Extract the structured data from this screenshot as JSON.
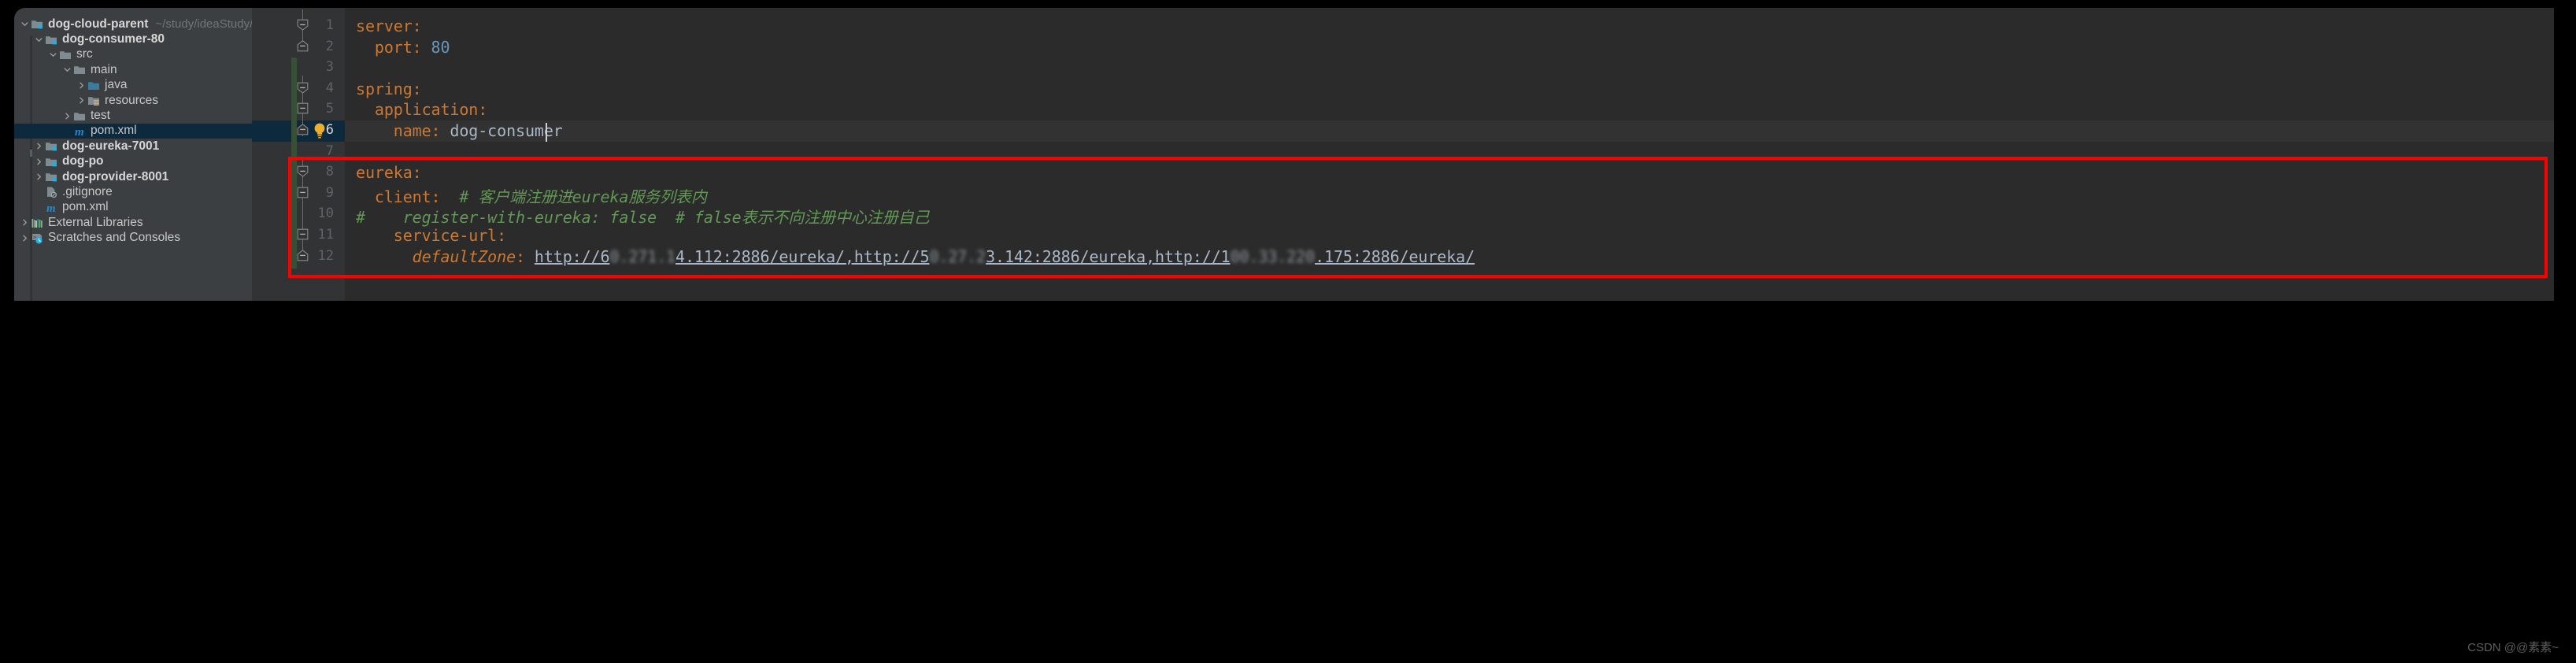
{
  "sidebar": {
    "items": [
      {
        "label": "dog-cloud-parent",
        "path": "~/study/ideaStudy/ideaS",
        "indent": 0,
        "arrow": "down",
        "icon": "module-folder-icon",
        "bold": true,
        "selected": false
      },
      {
        "label": "dog-consumer-80",
        "path": "",
        "indent": 1,
        "arrow": "down",
        "icon": "module-folder-icon",
        "bold": true,
        "selected": false
      },
      {
        "label": "src",
        "path": "",
        "indent": 2,
        "arrow": "down",
        "icon": "folder-icon",
        "bold": false,
        "selected": false
      },
      {
        "label": "main",
        "path": "",
        "indent": 3,
        "arrow": "down",
        "icon": "folder-icon",
        "bold": false,
        "selected": false
      },
      {
        "label": "java",
        "path": "",
        "indent": 4,
        "arrow": "right",
        "icon": "source-folder-icon",
        "bold": false,
        "selected": false
      },
      {
        "label": "resources",
        "path": "",
        "indent": 4,
        "arrow": "right",
        "icon": "resources-folder-icon",
        "bold": false,
        "selected": false
      },
      {
        "label": "test",
        "path": "",
        "indent": 3,
        "arrow": "right",
        "icon": "folder-icon",
        "bold": false,
        "selected": false
      },
      {
        "label": "pom.xml",
        "path": "",
        "indent": 3,
        "arrow": "none",
        "icon": "maven-icon",
        "bold": false,
        "selected": true
      },
      {
        "label": "dog-eureka-7001",
        "path": "",
        "indent": 1,
        "arrow": "right",
        "icon": "module-folder-icon",
        "bold": true,
        "selected": false
      },
      {
        "label": "dog-po",
        "path": "",
        "indent": 1,
        "arrow": "right",
        "icon": "module-folder-icon",
        "bold": true,
        "selected": false
      },
      {
        "label": "dog-provider-8001",
        "path": "",
        "indent": 1,
        "arrow": "right",
        "icon": "module-folder-icon",
        "bold": true,
        "selected": false
      },
      {
        "label": ".gitignore",
        "path": "",
        "indent": 1,
        "arrow": "none",
        "icon": "gitignore-icon",
        "bold": false,
        "selected": false
      },
      {
        "label": "pom.xml",
        "path": "",
        "indent": 1,
        "arrow": "none",
        "icon": "maven-icon",
        "bold": false,
        "selected": false
      },
      {
        "label": "External Libraries",
        "path": "",
        "indent": 0,
        "arrow": "right",
        "icon": "libraries-icon",
        "bold": false,
        "selected": false
      },
      {
        "label": "Scratches and Consoles",
        "path": "",
        "indent": 0,
        "arrow": "right",
        "icon": "scratches-icon",
        "bold": false,
        "selected": false
      }
    ]
  },
  "editor": {
    "line_numbers": [
      "1",
      "2",
      "3",
      "4",
      "5",
      "6",
      "7",
      "8",
      "9",
      "10",
      "11",
      "12"
    ],
    "current_line": 6,
    "lines": [
      {
        "num": 1,
        "segments": [
          {
            "t": "server",
            "c": "k"
          },
          {
            "t": ":",
            "c": "k"
          }
        ]
      },
      {
        "num": 2,
        "segments": [
          {
            "t": "  ",
            "c": "v"
          },
          {
            "t": "port",
            "c": "k"
          },
          {
            "t": ": ",
            "c": "k"
          },
          {
            "t": "80",
            "c": "n"
          }
        ]
      },
      {
        "num": 3,
        "segments": []
      },
      {
        "num": 4,
        "segments": [
          {
            "t": "spring",
            "c": "k"
          },
          {
            "t": ":",
            "c": "k"
          }
        ]
      },
      {
        "num": 5,
        "segments": [
          {
            "t": "  ",
            "c": "v"
          },
          {
            "t": "application",
            "c": "k"
          },
          {
            "t": ":",
            "c": "k"
          }
        ]
      },
      {
        "num": 6,
        "segments": [
          {
            "t": "    ",
            "c": "v"
          },
          {
            "t": "name",
            "c": "k"
          },
          {
            "t": ": ",
            "c": "k"
          },
          {
            "t": "dog-consumer",
            "c": "v"
          }
        ]
      },
      {
        "num": 7,
        "segments": []
      },
      {
        "num": 8,
        "segments": [
          {
            "t": "eureka",
            "c": "k"
          },
          {
            "t": ":",
            "c": "k"
          }
        ]
      },
      {
        "num": 9,
        "segments": [
          {
            "t": "  ",
            "c": "v"
          },
          {
            "t": "client",
            "c": "k"
          },
          {
            "t": ":",
            "c": "k"
          },
          {
            "t": "  ",
            "c": "v"
          },
          {
            "t": "# 客户端注册进eureka服务列表内",
            "c": "c"
          }
        ]
      },
      {
        "num": 10,
        "segments": [
          {
            "t": "#",
            "c": "c"
          },
          {
            "t": "    register-with-eureka: false  # false表示不向注册中心注册自己",
            "c": "c"
          }
        ]
      },
      {
        "num": 11,
        "segments": [
          {
            "t": "    ",
            "c": "v"
          },
          {
            "t": "service-url",
            "c": "k"
          },
          {
            "t": ":",
            "c": "k"
          }
        ]
      },
      {
        "num": 12,
        "segments": [
          {
            "t": "      ",
            "c": "v"
          },
          {
            "t": "defaultZone",
            "c": "ki"
          },
          {
            "t": ": ",
            "c": "k"
          }
        ]
      }
    ],
    "url_line": {
      "prefix": "http://6",
      "redacted_1": "0.271.1",
      "middle_1": "4.112:2886/eureka/,http://5",
      "redacted_2": "0.27.2",
      "middle_2": "3.142:2886/eureka,http://1",
      "redacted_3": "00.33.220",
      "suffix": ".175:2886/eureka/"
    },
    "intention_icon": "lightbulb-icon",
    "fold_markers": [
      "collapse",
      "collapse",
      "collapse",
      "collapse",
      "collapse",
      "collapse",
      "collapse",
      "collapse"
    ]
  },
  "annotation": {
    "red_box_color": "#fc0000"
  },
  "watermark": {
    "text": "CSDN @@素素~"
  }
}
